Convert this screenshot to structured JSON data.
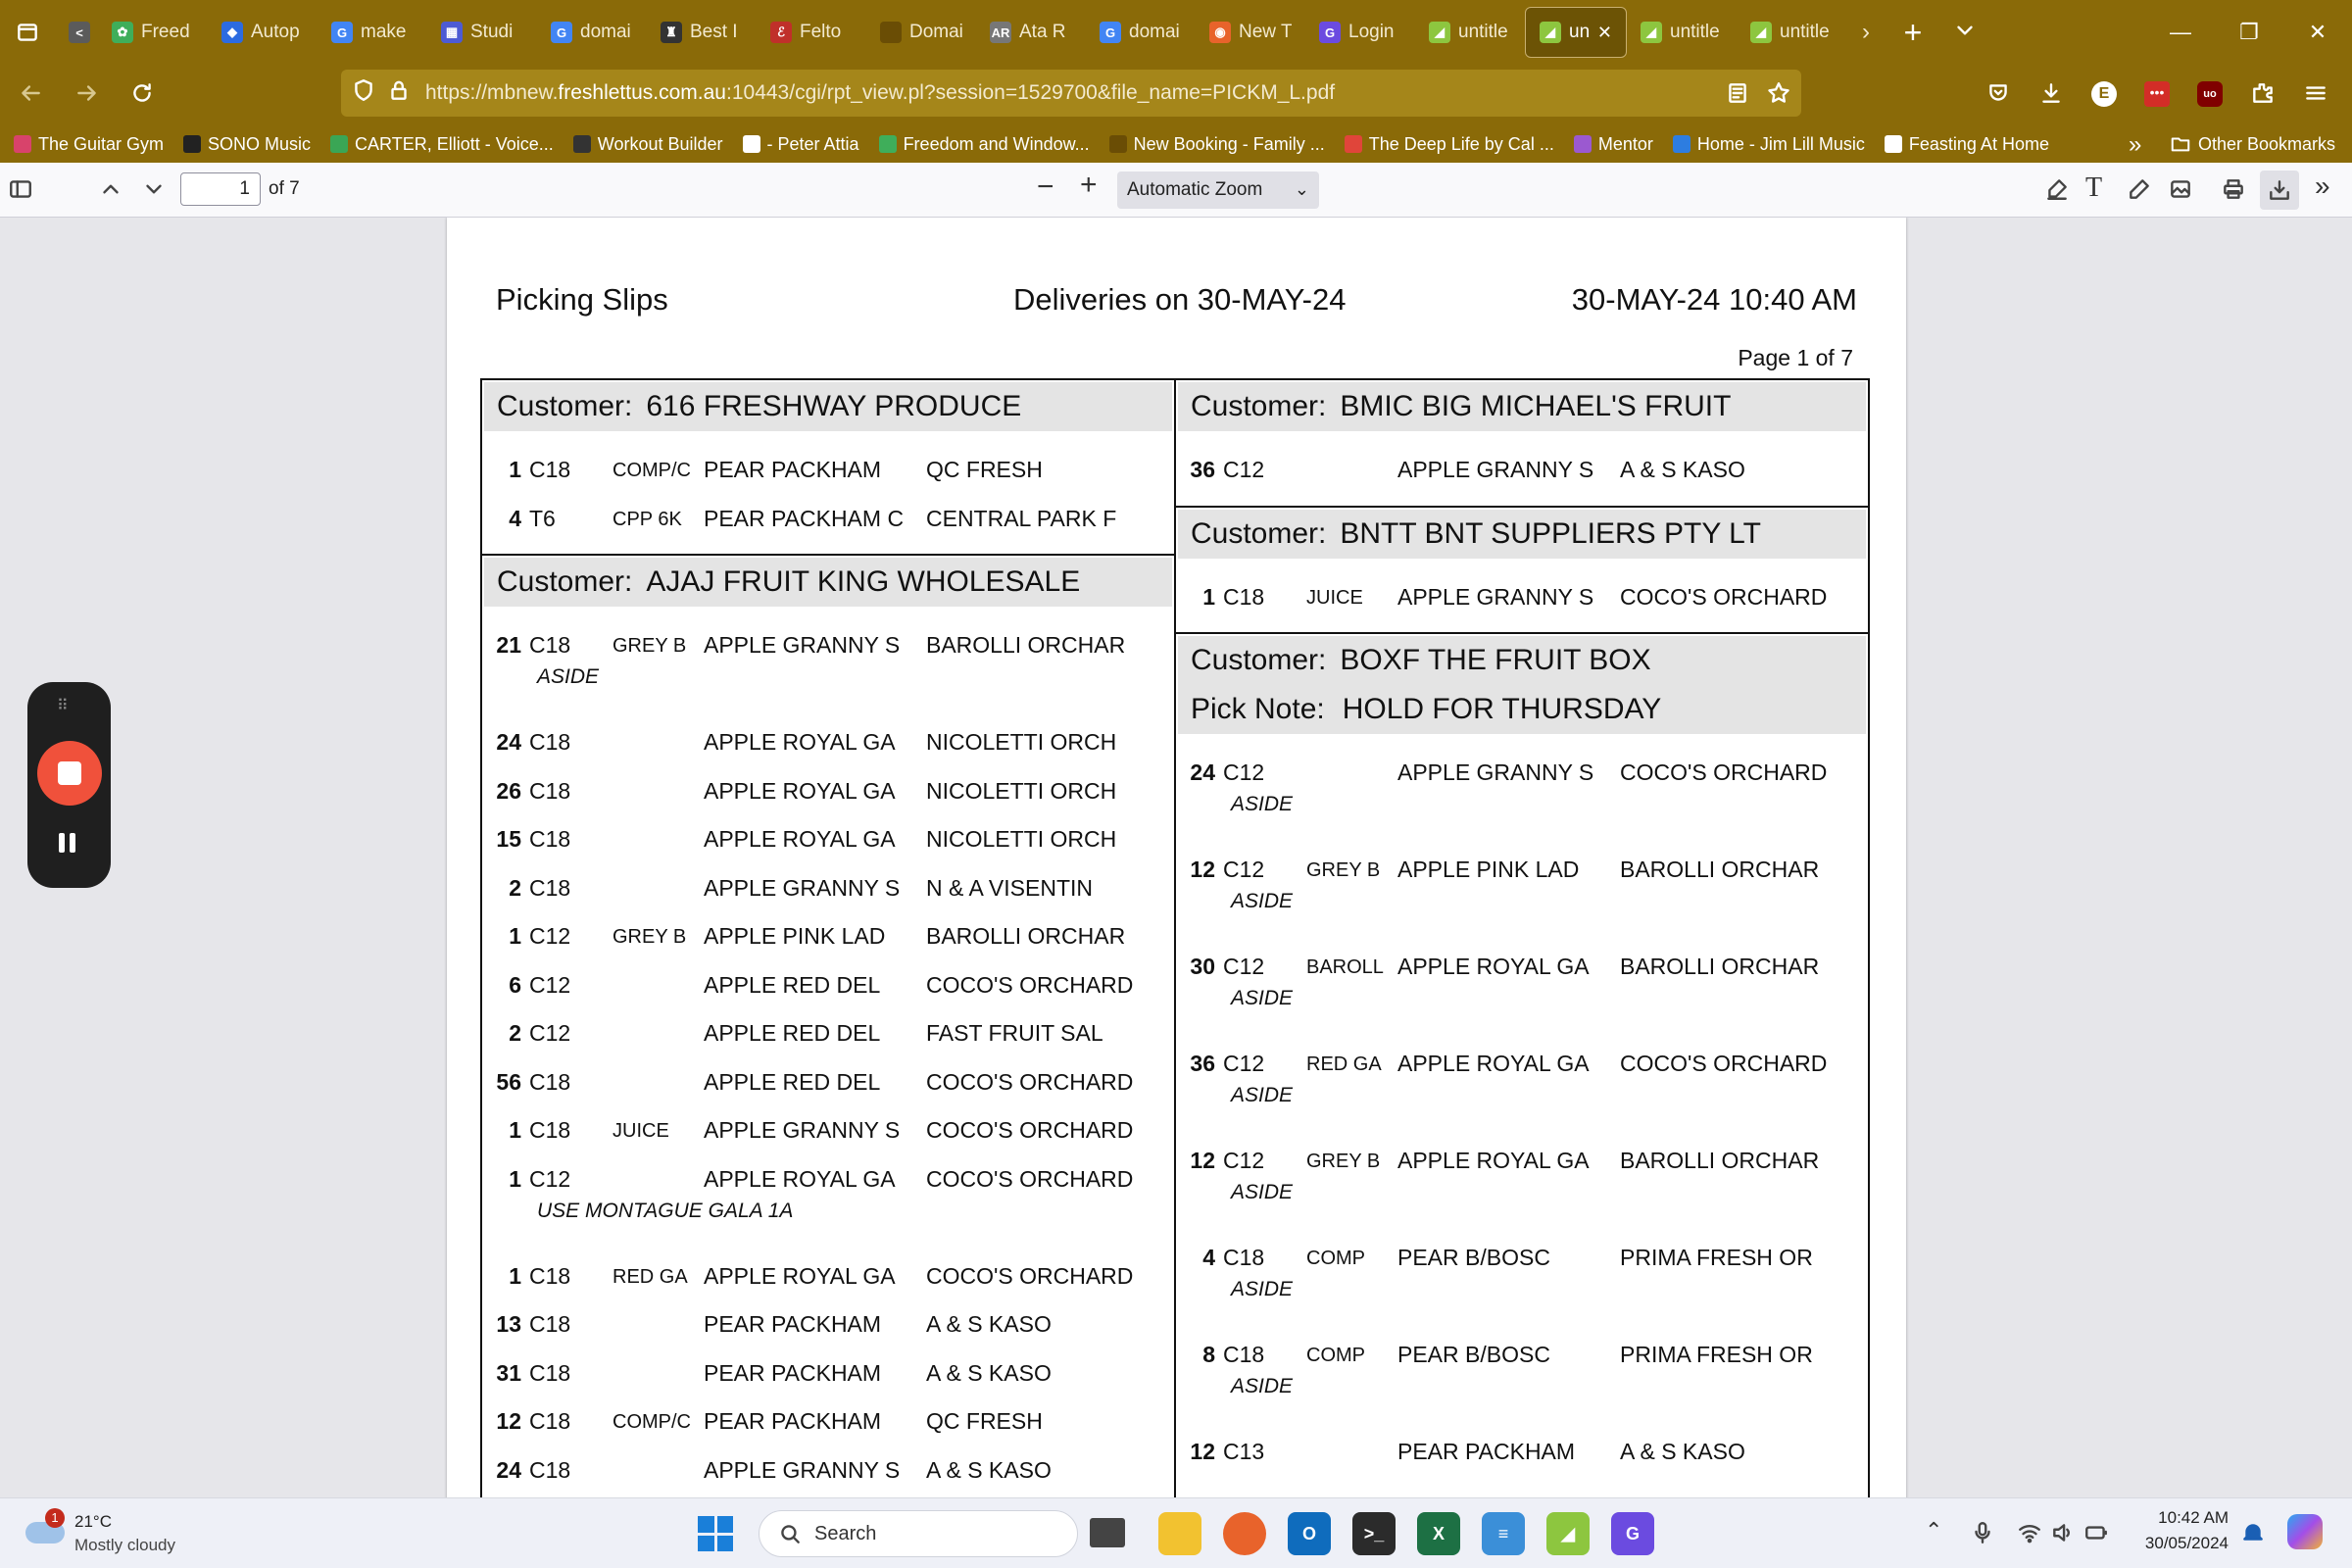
{
  "tabs": [
    {
      "label": "",
      "color": "#5b5b5b",
      "glyph": "<"
    },
    {
      "label": "Freed",
      "color": "#3fae5a",
      "glyph": "✿"
    },
    {
      "label": "Autop",
      "color": "#2c6be0",
      "glyph": "◆"
    },
    {
      "label": "make",
      "color": "#4285f4",
      "glyph": "G"
    },
    {
      "label": "Studi",
      "color": "#4d5bd4",
      "glyph": "▦"
    },
    {
      "label": "domai",
      "color": "#4285f4",
      "glyph": "G"
    },
    {
      "label": "Best I",
      "color": "#333333",
      "glyph": "♜"
    },
    {
      "label": "Felto",
      "color": "#c0302a",
      "glyph": "ℰ"
    },
    {
      "label": "Domaine I",
      "color": "#6a4d05",
      "glyph": ""
    },
    {
      "label": "Ata R",
      "color": "#777777",
      "glyph": "AR"
    },
    {
      "label": "domai",
      "color": "#4285f4",
      "glyph": "G"
    },
    {
      "label": "New T",
      "color": "#e8632b",
      "glyph": "◉"
    },
    {
      "label": "Login",
      "color": "#6b4be0",
      "glyph": "G"
    },
    {
      "label": "untitle",
      "color": "#8dc63f",
      "glyph": "◢"
    },
    {
      "label": "unt",
      "color": "#8dc63f",
      "glyph": "◢",
      "active": true
    },
    {
      "label": "untitle",
      "color": "#8dc63f",
      "glyph": "◢"
    },
    {
      "label": "untitle",
      "color": "#8dc63f",
      "glyph": "◢"
    }
  ],
  "url": {
    "pre": "https://mbnew.",
    "domain": "freshlettus.com.au",
    "post": ":10443/cgi/rpt_view.pl?session=1529700&file_name=PICKM_L.pdf"
  },
  "bookmarks": [
    {
      "label": "The Guitar Gym",
      "color": "#d8436b"
    },
    {
      "label": "SONO Music",
      "color": "#222222"
    },
    {
      "label": "CARTER, Elliott - Voice...",
      "color": "#3aa655"
    },
    {
      "label": "Workout Builder",
      "color": "#333333"
    },
    {
      "label": "- Peter Attia",
      "color": "#ffffff"
    },
    {
      "label": "Freedom and Window...",
      "color": "#3fae5a"
    },
    {
      "label": "New Booking - Family ...",
      "color": "#6a4d05"
    },
    {
      "label": "The Deep Life by Cal ...",
      "color": "#e0453a"
    },
    {
      "label": "Mentor",
      "color": "#9b59d0"
    },
    {
      "label": "Home - Jim Lill Music",
      "color": "#2d7de0"
    },
    {
      "label": "Feasting At Home",
      "color": "#ffffff"
    }
  ],
  "bookmarks_other": "Other Bookmarks",
  "pdf": {
    "page_current": "1",
    "page_total": "of 7",
    "zoom": "Automatic Zoom",
    "title": "Picking Slips",
    "deliveries": "Deliveries on 30-MAY-24",
    "printed": "30-MAY-24 10:40 AM",
    "page_label": "Page 1 of 7",
    "customer_prefix": "Customer:",
    "pick_note_prefix": "Pick Note:",
    "left_column": [
      {
        "customer": "616  FRESHWAY PRODUCE",
        "rows": [
          {
            "qty": "1",
            "code": "C18",
            "grade": "COMP/C",
            "product": "PEAR PACKHAM",
            "grower": "QC FRESH"
          },
          {
            "qty": "4",
            "code": "T6",
            "grade": "CPP 6K",
            "product": "PEAR PACKHAM C",
            "grower": "CENTRAL PARK F"
          }
        ]
      },
      {
        "customer": "AJAJ  FRUIT KING WHOLESALE",
        "rows": [
          {
            "qty": "21",
            "code": "C18",
            "grade": "GREY B",
            "product": "APPLE GRANNY S",
            "grower": "BAROLLI ORCHAR",
            "note": "ASIDE"
          },
          {
            "qty": "24",
            "code": "C18",
            "grade": "",
            "product": "APPLE ROYAL GA",
            "grower": "NICOLETTI ORCH"
          },
          {
            "qty": "26",
            "code": "C18",
            "grade": "",
            "product": "APPLE ROYAL GA",
            "grower": "NICOLETTI ORCH"
          },
          {
            "qty": "15",
            "code": "C18",
            "grade": "",
            "product": "APPLE ROYAL GA",
            "grower": "NICOLETTI ORCH"
          },
          {
            "qty": "2",
            "code": "C18",
            "grade": "",
            "product": "APPLE GRANNY S",
            "grower": "N & A VISENTIN"
          },
          {
            "qty": "1",
            "code": "C12",
            "grade": "GREY B",
            "product": "APPLE PINK LAD",
            "grower": "BAROLLI ORCHAR"
          },
          {
            "qty": "6",
            "code": "C12",
            "grade": "",
            "product": "APPLE RED DEL",
            "grower": "COCO'S ORCHARD"
          },
          {
            "qty": "2",
            "code": "C12",
            "grade": "",
            "product": "APPLE RED DEL",
            "grower": "FAST FRUIT SAL"
          },
          {
            "qty": "56",
            "code": "C18",
            "grade": "",
            "product": "APPLE RED DEL",
            "grower": "COCO'S ORCHARD"
          },
          {
            "qty": "1",
            "code": "C18",
            "grade": "JUICE",
            "product": "APPLE GRANNY S",
            "grower": "COCO'S ORCHARD"
          },
          {
            "qty": "1",
            "code": "C12",
            "grade": "",
            "product": "APPLE ROYAL GA",
            "grower": "COCO'S ORCHARD",
            "note": "USE MONTAGUE GALA 1A"
          },
          {
            "qty": "1",
            "code": "C18",
            "grade": "RED GA",
            "product": "APPLE ROYAL GA",
            "grower": "COCO'S ORCHARD"
          },
          {
            "qty": "13",
            "code": "C18",
            "grade": "",
            "product": "PEAR PACKHAM",
            "grower": "A & S KASO"
          },
          {
            "qty": "31",
            "code": "C18",
            "grade": "",
            "product": "PEAR PACKHAM",
            "grower": "A & S KASO"
          },
          {
            "qty": "12",
            "code": "C18",
            "grade": "COMP/C",
            "product": "PEAR PACKHAM",
            "grower": "QC FRESH"
          },
          {
            "qty": "24",
            "code": "C18",
            "grade": "",
            "product": "APPLE GRANNY S",
            "grower": "A & S KASO"
          }
        ]
      }
    ],
    "right_column": [
      {
        "customer": "BMIC  BIG MICHAEL'S FRUIT",
        "rows": [
          {
            "qty": "36",
            "code": "C12",
            "grade": "",
            "product": "APPLE GRANNY S",
            "grower": "A & S KASO"
          }
        ]
      },
      {
        "customer": "BNTT  BNT SUPPLIERS PTY LT",
        "rows": [
          {
            "qty": "1",
            "code": "C18",
            "grade": "JUICE",
            "product": "APPLE GRANNY S",
            "grower": "COCO'S ORCHARD"
          }
        ]
      },
      {
        "customer": "BOXF  THE FRUIT BOX",
        "pick_note": "HOLD FOR THURSDAY",
        "rows": [
          {
            "qty": "24",
            "code": "C12",
            "grade": "",
            "product": "APPLE GRANNY S",
            "grower": "COCO'S ORCHARD",
            "note": "ASIDE"
          },
          {
            "qty": "12",
            "code": "C12",
            "grade": "GREY B",
            "product": "APPLE PINK LAD",
            "grower": "BAROLLI ORCHAR",
            "note": "ASIDE"
          },
          {
            "qty": "30",
            "code": "C12",
            "grade": "BAROLL",
            "product": "APPLE ROYAL GA",
            "grower": "BAROLLI ORCHAR",
            "note": "ASIDE"
          },
          {
            "qty": "36",
            "code": "C12",
            "grade": "RED GA",
            "product": "APPLE ROYAL GA",
            "grower": "COCO'S ORCHARD",
            "note": "ASIDE"
          },
          {
            "qty": "12",
            "code": "C12",
            "grade": "GREY B",
            "product": "APPLE ROYAL GA",
            "grower": "BAROLLI ORCHAR",
            "note": "ASIDE"
          },
          {
            "qty": "4",
            "code": "C18",
            "grade": "COMP",
            "product": "PEAR B/BOSC",
            "grower": "PRIMA FRESH OR",
            "note": "ASIDE"
          },
          {
            "qty": "8",
            "code": "C18",
            "grade": "COMP",
            "product": "PEAR B/BOSC",
            "grower": "PRIMA FRESH OR",
            "note": "ASIDE"
          },
          {
            "qty": "12",
            "code": "C13",
            "grade": "",
            "product": "PEAR PACKHAM",
            "grower": "A & S KASO"
          }
        ]
      }
    ]
  },
  "taskbar": {
    "weather_temp": "21°C",
    "weather_desc": "Mostly cloudy",
    "weather_badge": "1",
    "search_placeholder": "Search",
    "time": "10:42 AM",
    "date": "30/05/2024"
  }
}
